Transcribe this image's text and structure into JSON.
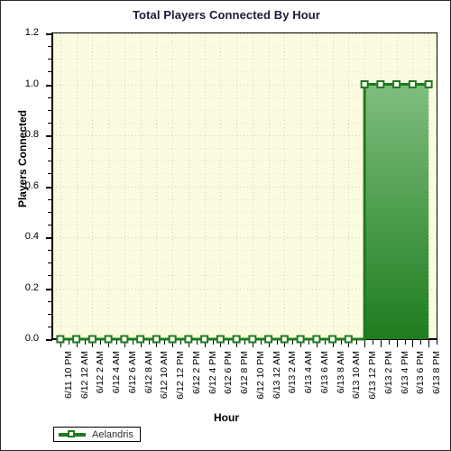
{
  "chart_data": {
    "type": "area",
    "title": "Total Players Connected By Hour",
    "xlabel": "Hour",
    "ylabel": "Players Connected",
    "ylim": [
      0,
      1.2
    ],
    "ytick_step": 0.2,
    "grid": true,
    "legend_position": "bottom-left",
    "categories": [
      "6/11 10 PM",
      "6/12 12 AM",
      "6/12 2 AM",
      "6/12 4 AM",
      "6/12 6 AM",
      "6/12 8 AM",
      "6/12 10 AM",
      "6/12 12 PM",
      "6/12 2 PM",
      "6/12 4 PM",
      "6/12 6 PM",
      "6/12 8 PM",
      "6/12 10 PM",
      "6/13 12 AM",
      "6/13 2 AM",
      "6/13 4 AM",
      "6/13 6 AM",
      "6/13 8 AM",
      "6/13 10 AM",
      "6/13 12 PM",
      "6/13 2 PM",
      "6/13 4 PM",
      "6/13 6 PM",
      "6/13 8 PM"
    ],
    "y_tick_labels": [
      "0.0",
      "0.2",
      "0.4",
      "0.6",
      "0.8",
      "1.0",
      "1.2"
    ],
    "y_tick_values": [
      0.0,
      0.2,
      0.4,
      0.6,
      0.8,
      1.0,
      1.2
    ],
    "series": [
      {
        "name": "Aelandris",
        "color": "#1f7a1f",
        "fill_top_color": "#7fbe7f",
        "fill_bottom_color": "#238b23",
        "marker": "square",
        "marker_fill": "#ffffff",
        "values": [
          0,
          0,
          0,
          0,
          0,
          0,
          0,
          0,
          0,
          0,
          0,
          0,
          0,
          0,
          0,
          0,
          0,
          0,
          0,
          1,
          1,
          1,
          1,
          1
        ]
      }
    ]
  },
  "legend": {
    "entries": [
      {
        "label": "Aelandris"
      }
    ]
  },
  "colors": {
    "plot_background": "#fbfbe0",
    "page_background": "#ffffff",
    "axis": "#000000",
    "title_text": "#1b1b38",
    "grid": "#cfcfb4",
    "series_green": "#1f7a1f"
  }
}
